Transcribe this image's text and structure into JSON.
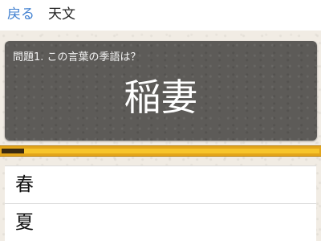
{
  "header": {
    "back_label": "戻る",
    "title": "天文"
  },
  "question": {
    "label": "問題1. この言葉の季語は？",
    "word": "稲妻"
  },
  "timer": {
    "elapsed_fraction": 0.07,
    "colors": {
      "frame": "#e3a51a",
      "remaining": "#f7c52b",
      "elapsed": "#3a2a10"
    }
  },
  "answers": [
    {
      "label": "春"
    },
    {
      "label": "夏"
    }
  ],
  "colors": {
    "link": "#3f7fd0",
    "card": "#5d5b58",
    "background": "#f1ece4"
  }
}
